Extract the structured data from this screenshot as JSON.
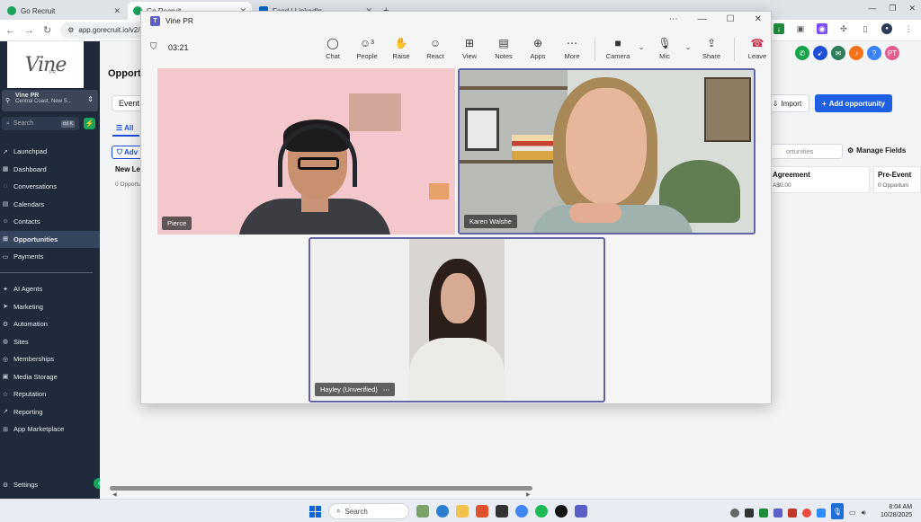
{
  "browser": {
    "tabs": [
      {
        "title": "Go Recruit",
        "active": false
      },
      {
        "title": "Go Recruit",
        "active": true
      },
      {
        "title": "Feed | LinkedIn",
        "active": false
      }
    ],
    "url": "app.gorecruit.io/v2/locat"
  },
  "sidebar": {
    "logo_text": "Vine",
    "logo_sub": "PR",
    "account_name": "Vine PR",
    "account_location": "Central Coast, New S...",
    "search_placeholder": "Search",
    "search_shortcut": "ctrl K",
    "nav_primary": [
      {
        "label": "Launchpad",
        "icon": "rocket-icon"
      },
      {
        "label": "Dashboard",
        "icon": "dashboard-icon"
      },
      {
        "label": "Conversations",
        "icon": "chat-icon"
      },
      {
        "label": "Calendars",
        "icon": "calendar-icon"
      },
      {
        "label": "Contacts",
        "icon": "contacts-icon"
      },
      {
        "label": "Opportunities",
        "icon": "funnel-icon",
        "active": true
      },
      {
        "label": "Payments",
        "icon": "payments-icon"
      }
    ],
    "nav_secondary": [
      {
        "label": "AI Agents",
        "icon": "sparkle-icon"
      },
      {
        "label": "Marketing",
        "icon": "megaphone-icon"
      },
      {
        "label": "Automation",
        "icon": "automation-icon"
      },
      {
        "label": "Sites",
        "icon": "globe-icon"
      },
      {
        "label": "Memberships",
        "icon": "membership-icon"
      },
      {
        "label": "Media Storage",
        "icon": "folder-icon"
      },
      {
        "label": "Reputation",
        "icon": "star-icon"
      },
      {
        "label": "Reporting",
        "icon": "chart-icon"
      },
      {
        "label": "App Marketplace",
        "icon": "apps-icon"
      }
    ],
    "settings_label": "Settings"
  },
  "main": {
    "title": "Opportu",
    "view_select": "Event",
    "tab_all": "All",
    "advanced_button": "Adv",
    "import_button": "Import",
    "add_button": "Add opportunity",
    "search_placeholder": "ortunities",
    "manage_fields": "Manage Fields",
    "left_column": {
      "title": "New Le",
      "sub": "0 Opportu"
    },
    "stages": [
      {
        "title": "Agreement",
        "value": "A$0.00"
      },
      {
        "title": "Pre-Event",
        "value": "0 Opportuni"
      }
    ]
  },
  "header_buttons": [
    {
      "icon": "phone-icon",
      "color": "#16a34a"
    },
    {
      "icon": "megaphone-icon",
      "color": "#1d4ed8"
    },
    {
      "icon": "chat-icon",
      "color": "#2e7d5b"
    },
    {
      "icon": "bell-icon",
      "color": "#f97316"
    },
    {
      "icon": "help-icon",
      "color": "#3b82f6"
    },
    {
      "icon": "avatar-icon",
      "color": "#e25c8c",
      "label": "PT"
    }
  ],
  "teams": {
    "window_title": "Vine PR",
    "timer": "03:21",
    "people_count": "3",
    "toolbar": {
      "chat": "Chat",
      "people": "People",
      "raise": "Raise",
      "react": "React",
      "view": "View",
      "notes": "Notes",
      "apps": "Apps",
      "more": "More",
      "camera": "Camera",
      "mic": "Mic",
      "share": "Share",
      "leave": "Leave"
    },
    "participants": [
      {
        "name": "Pierce"
      },
      {
        "name": "Karen Walshe"
      },
      {
        "name": "Hayley (Unverified)"
      }
    ]
  },
  "taskbar": {
    "search": "Search",
    "time": "8:04 AM",
    "date": "10/28/2025"
  }
}
